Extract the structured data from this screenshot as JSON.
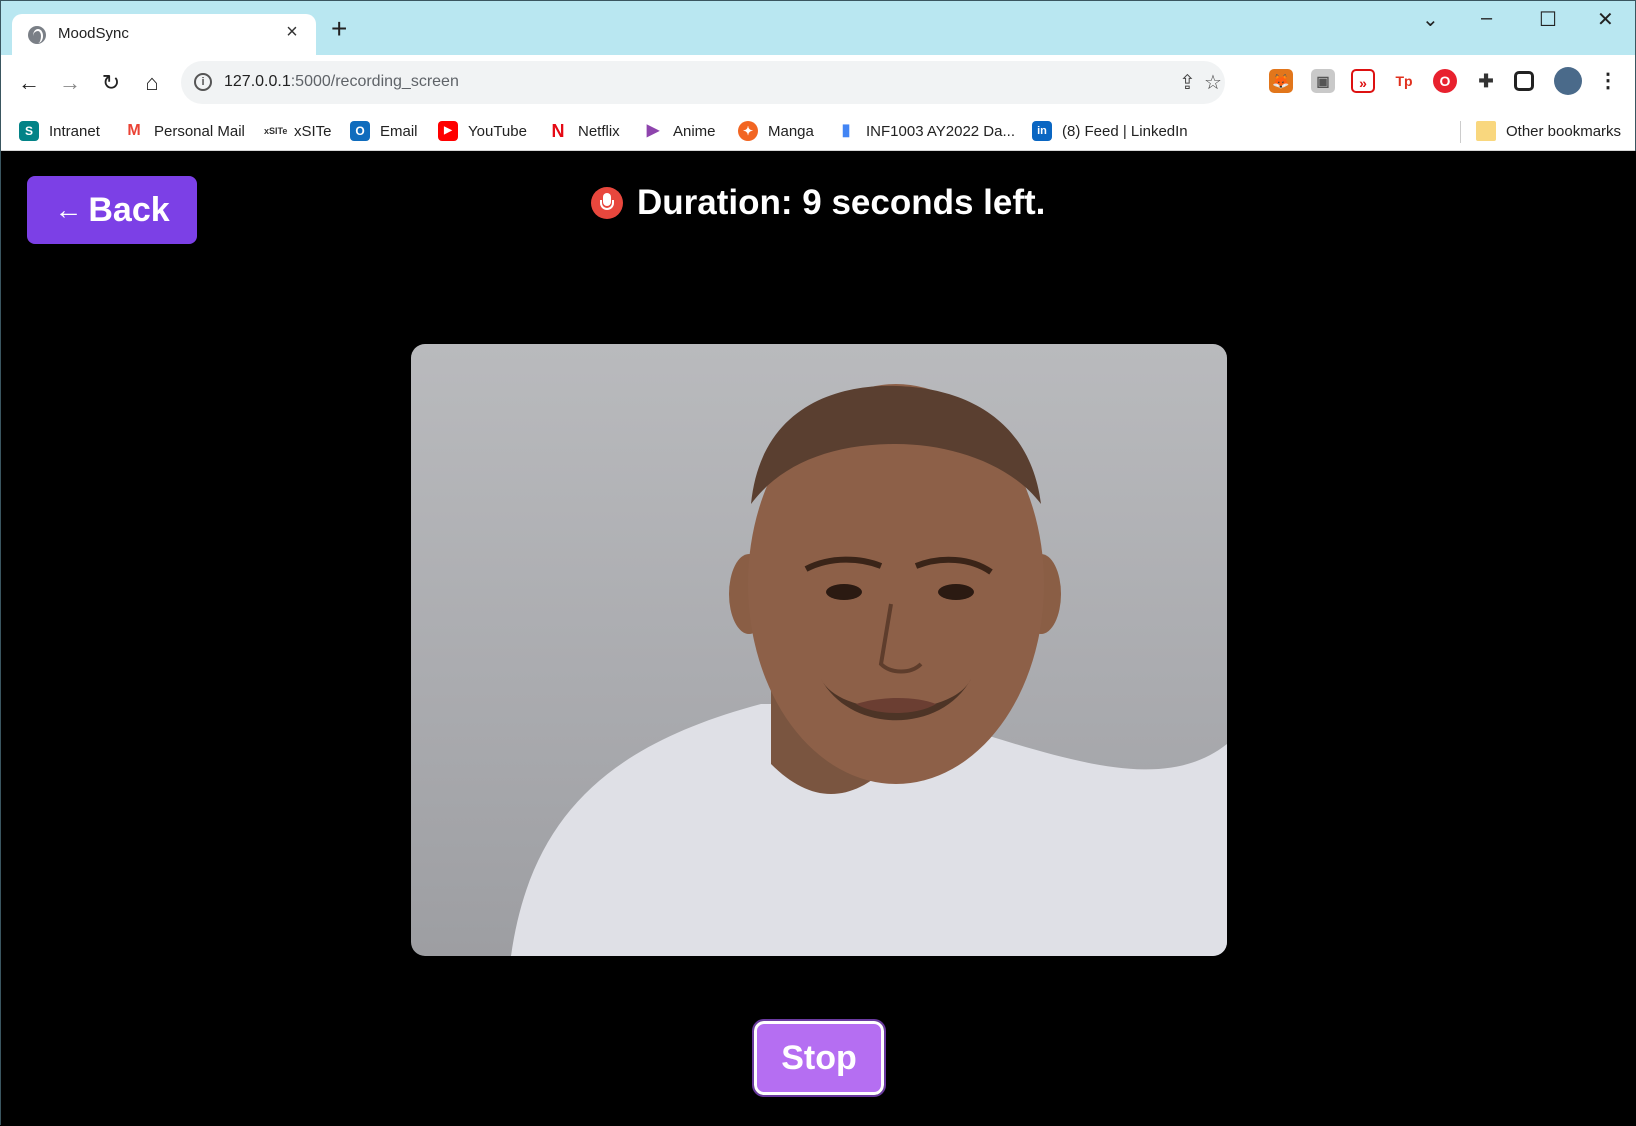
{
  "browser": {
    "tab_title": "MoodSync",
    "new_tab": "+",
    "tab_close": "×",
    "url_host": "127.0.0.1",
    "url_path": ":5000/recording_screen"
  },
  "bookmarks": [
    {
      "label": "Intranet",
      "icon": "sharepoint-icon",
      "color": "#038387"
    },
    {
      "label": "Personal Mail",
      "icon": "gmail-icon",
      "color": "#ea4335"
    },
    {
      "label": "xSITe",
      "icon": "xsite-icon",
      "color": "#333333"
    },
    {
      "label": "Email",
      "icon": "outlook-icon",
      "color": "#0f6cbd"
    },
    {
      "label": "YouTube",
      "icon": "youtube-icon",
      "color": "#ff0000"
    },
    {
      "label": "Netflix",
      "icon": "netflix-icon",
      "color": "#e50914"
    },
    {
      "label": "Anime",
      "icon": "play-icon",
      "color": "#8e44ad"
    },
    {
      "label": "Manga",
      "icon": "manga-icon",
      "color": "#f26522"
    },
    {
      "label": "INF1003 AY2022 Da...",
      "icon": "bar-chart-icon",
      "color": "#4285f4"
    },
    {
      "label": "(8) Feed | LinkedIn",
      "icon": "linkedin-icon",
      "color": "#0a66c2"
    },
    {
      "label": "Other bookmarks",
      "icon": "folder-icon",
      "color": "#f9d77e"
    }
  ],
  "page": {
    "back_label": "Back",
    "duration_text": "Duration: 9 seconds left.",
    "stop_label": "Stop",
    "accent_color": "#7c40e6",
    "stop_color": "#b56ef2"
  }
}
